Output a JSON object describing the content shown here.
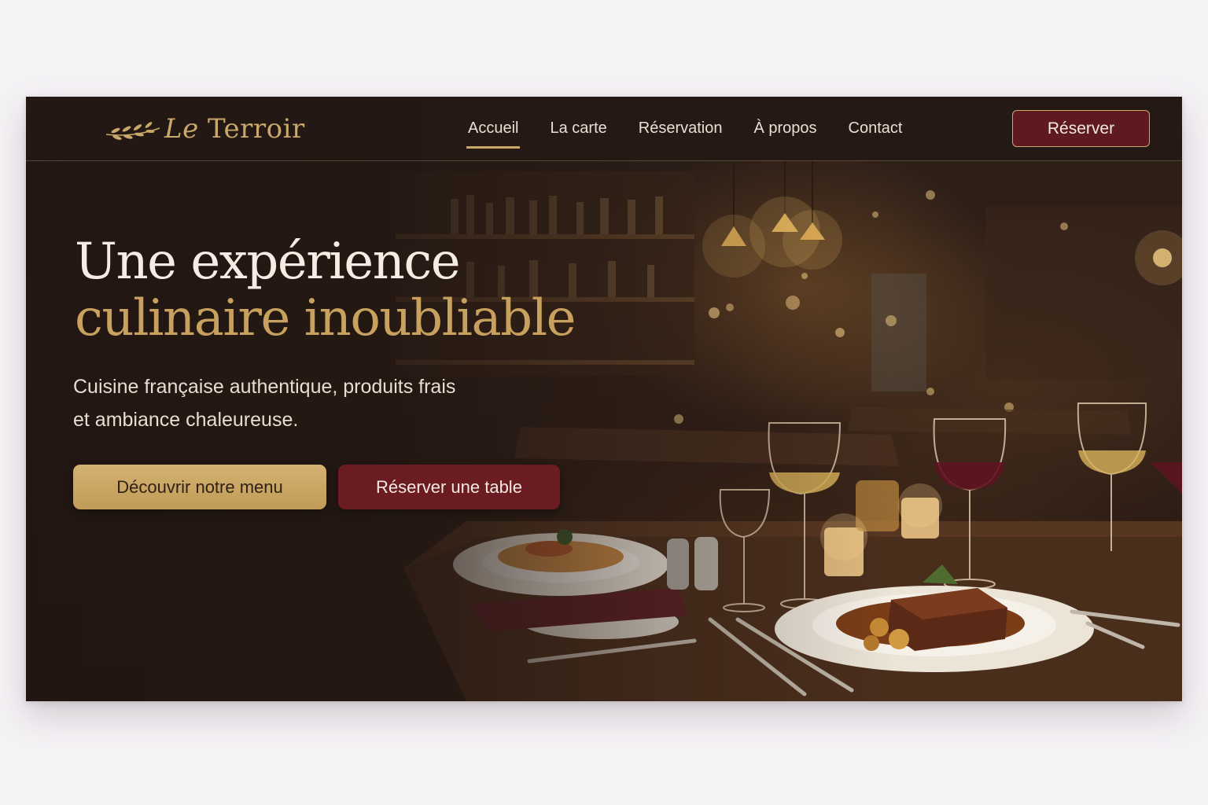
{
  "brand": {
    "name_prefix": "Le",
    "name_rest": "Terroir",
    "icon": "laurel-branch-icon",
    "accent_color": "#c9a86a",
    "wine_color": "#6a1c22"
  },
  "nav": {
    "items": [
      {
        "label": "Accueil",
        "active": true
      },
      {
        "label": "La carte",
        "active": false
      },
      {
        "label": "Réservation",
        "active": false
      },
      {
        "label": "À propos",
        "active": false
      },
      {
        "label": "Contact",
        "active": false
      }
    ],
    "cta_label": "Réserver"
  },
  "hero": {
    "title_line1": "Une expérience",
    "title_line2": "culinaire inoubliable",
    "subtitle_line1": "Cuisine française authentique, produits frais",
    "subtitle_line2": "et ambiance chaleureuse.",
    "primary_button": "Découvrir notre menu",
    "secondary_button": "Réserver une table"
  }
}
